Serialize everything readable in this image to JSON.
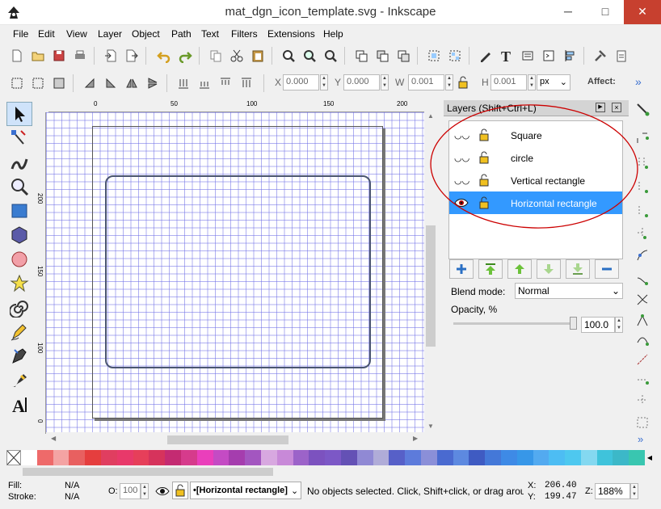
{
  "window": {
    "title": "mat_dgn_icon_template.svg - Inkscape",
    "min_glyph": "─",
    "max_glyph": "□",
    "close_glyph": "✕"
  },
  "menu": [
    "File",
    "Edit",
    "View",
    "Layer",
    "Object",
    "Path",
    "Text",
    "Filters",
    "Extensions",
    "Help"
  ],
  "controls": {
    "x_label": "X",
    "x_value": "0.000",
    "y_label": "Y",
    "y_value": "0.000",
    "w_label": "W",
    "w_value": "0.001",
    "h_label": "H",
    "h_value": "0.001",
    "unit": "px",
    "affect": "Affect:",
    "more": "»"
  },
  "rulers": {
    "h": [
      "0",
      "50",
      "100",
      "150",
      "200"
    ],
    "v": [
      "0",
      "50",
      "100",
      "150",
      "200"
    ]
  },
  "layers": {
    "title": "Layers (Shift+Ctrl+L)",
    "items": [
      {
        "name": "Square",
        "selected": false
      },
      {
        "name": "circle",
        "selected": false
      },
      {
        "name": "Vertical rectangle",
        "selected": false
      },
      {
        "name": "Horizontal rectangle",
        "selected": true
      }
    ],
    "blend_label": "Blend mode:",
    "blend_value": "Normal",
    "opacity_label": "Opacity, %",
    "opacity_value": "100.0",
    "opacity_fraction": 1.0
  },
  "palette": [
    "#ffffff",
    "#ee6a6a",
    "#f4a3a3",
    "#e86060",
    "#e53e3e",
    "#e03e60",
    "#e8396a",
    "#e63f5a",
    "#d6335c",
    "#c42b72",
    "#d63b8c",
    "#ea3fbb",
    "#c44bc4",
    "#a53dae",
    "#a356c0",
    "#d8a8e0",
    "#c889d8",
    "#9c63c9",
    "#7c52bf",
    "#7c58c6",
    "#6451b5",
    "#9089d4",
    "#b0acd8",
    "#5760c8",
    "#5d7bdb",
    "#8b8fd8",
    "#4a6ad0",
    "#5d89e0",
    "#3f5bc2",
    "#4478d8",
    "#3e8ae6",
    "#3797e8",
    "#53aaf0",
    "#4dbdf3",
    "#4ec8ef",
    "#84d8f0",
    "#3fc3db",
    "#3cb8c8",
    "#39c6b0"
  ],
  "status": {
    "fill_label": "Fill:",
    "fill_value": "N/A",
    "stroke_label": "Stroke:",
    "stroke_value": "N/A",
    "opacity_label": "O:",
    "opacity_value": "100",
    "layer_value": "•[Horizontal rectangle]",
    "message": "No objects selected. Click, Shift+click, or drag arou...",
    "x_label": "X:",
    "x_value": "206.40",
    "y_label": "Y:",
    "y_value": "199.47",
    "zoom_label": "Z:",
    "zoom_value": "188%"
  },
  "colors": {
    "selection": "#3399ff",
    "annotation": "#cc0000",
    "grid": "#6e6ee6",
    "close_button": "#c7402f"
  }
}
